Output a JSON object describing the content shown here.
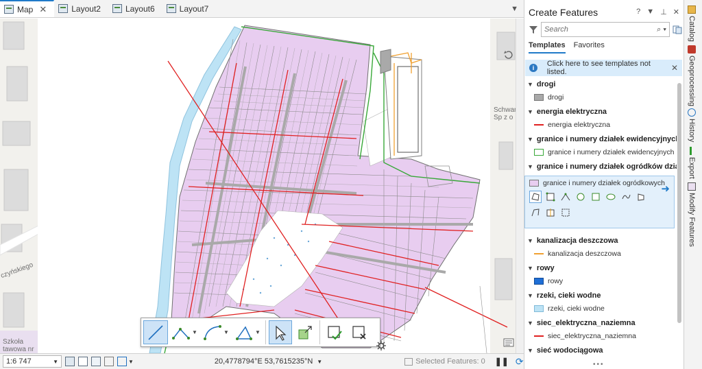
{
  "tabs": [
    {
      "label": "Map",
      "active": true,
      "closable": true
    },
    {
      "label": "Layout2",
      "active": false
    },
    {
      "label": "Layout6",
      "active": false
    },
    {
      "label": "Layout7",
      "active": false
    }
  ],
  "map": {
    "basemap_labels": {
      "company_line1": "Schwarte",
      "company_line2": "Sp z o",
      "street": "czyńskiego",
      "school_line1": "Szkoła",
      "school_line2": "tawowa nr"
    },
    "colors": {
      "plot_fill": "#e8cdf0",
      "plot_outline": "#7a7a7a",
      "road_fill": "#a9a9a9",
      "power_line": "#e02020",
      "parcel_boundary": "#38a838",
      "river": "#bde3f5",
      "pond_background": "#ffffff",
      "drainage": "#f0a030"
    }
  },
  "edit_toolbar": {
    "tools": [
      "line-tool",
      "polyline-tool",
      "arc-tool",
      "polygon-tool",
      "select-tool",
      "reshape-tool",
      "finish-tool",
      "cancel-tool"
    ]
  },
  "status_bar": {
    "scale": "1:6 747",
    "coordinates": "20,4778794°E 53,7615235°N",
    "selected_features": "Selected Features: 0"
  },
  "pane": {
    "title": "Create Features",
    "help_glyph": "?",
    "search_placeholder": "Search",
    "tabs": [
      "Templates",
      "Favorites"
    ],
    "info_message": "Click here to see templates not listed.",
    "groups": [
      {
        "name": "drogi",
        "item": "drogi",
        "symbol": "fill",
        "color": "#a9a9a9"
      },
      {
        "name": "energia elektryczna",
        "item": "energia elektryczna",
        "symbol": "line",
        "color": "#e02020"
      },
      {
        "name": "granice i numery działek ewidencyjnych",
        "item": "granice i numery działek ewidencyjnych",
        "symbol": "outline",
        "color": "#38a838"
      },
      {
        "name": "granice i numery działek ogródków działkowych",
        "item": "granice i numery działek ogródkowych",
        "symbol": "fill",
        "color": "#e8cdf0",
        "selected": true
      },
      {
        "name": "kanalizacja deszczowa",
        "item": "kanalizacja deszczowa",
        "symbol": "line",
        "color": "#f0a030"
      },
      {
        "name": "rowy",
        "item": "rowy",
        "symbol": "fill",
        "color": "#1f6fd6"
      },
      {
        "name": "rzeki, cieki wodne",
        "item": "rzeki, cieki wodne",
        "symbol": "fill",
        "color": "#bde3f5"
      },
      {
        "name": "siec_elektryczna_naziemna",
        "item": "siec_elektryczna_naziemna",
        "symbol": "line",
        "color": "#e02020"
      },
      {
        "name": "sieć wodociągowa",
        "item": "",
        "symbol": "",
        "color": ""
      }
    ],
    "more_indicator": "•••"
  },
  "dock": [
    "Catalog",
    "Geoprocessing",
    "History",
    "Export",
    "Modify Features"
  ]
}
